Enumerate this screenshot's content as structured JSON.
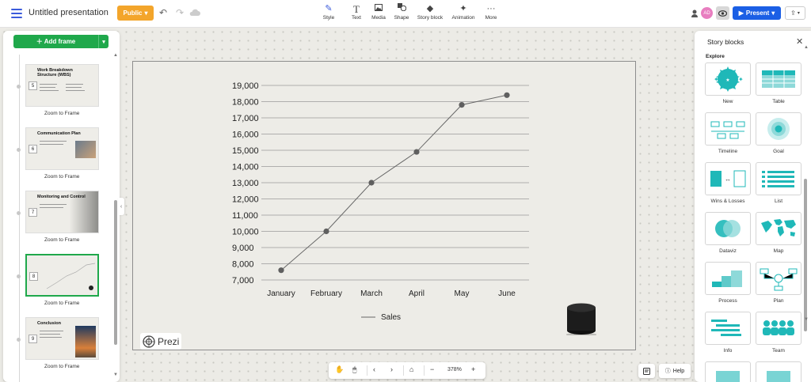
{
  "topbar": {
    "title": "Untitled presentation",
    "public_label": "Public",
    "tools": [
      {
        "label": "Style",
        "icon": "brush-icon"
      },
      {
        "label": "Text",
        "icon": "text-icon"
      },
      {
        "label": "Media",
        "icon": "image-icon"
      },
      {
        "label": "Shape",
        "icon": "shape-icon"
      },
      {
        "label": "Story block",
        "icon": "layers-icon"
      },
      {
        "label": "Animation",
        "icon": "animation-icon"
      },
      {
        "label": "More",
        "icon": "more-icon"
      }
    ],
    "avatar_initials": "AD",
    "present_label": "Present"
  },
  "left_panel": {
    "add_frame_label": "Add frame",
    "frames": [
      {
        "number": "5",
        "title": "Work Breakdown Structure (WBS)",
        "zoom_label": "Zoom to Frame"
      },
      {
        "number": "6",
        "title": "Communication Plan",
        "zoom_label": "Zoom to Frame"
      },
      {
        "number": "7",
        "title": "Monitoring and Control",
        "zoom_label": "Zoom to Frame"
      },
      {
        "number": "8",
        "title": "",
        "zoom_label": "Zoom to Frame"
      },
      {
        "number": "9",
        "title": "Conclusion",
        "zoom_label": "Zoom to Frame"
      }
    ]
  },
  "chart_data": {
    "type": "line",
    "categories": [
      "January",
      "February",
      "March",
      "April",
      "May",
      "June"
    ],
    "series": [
      {
        "name": "Sales",
        "values": [
          7600,
          10000,
          13000,
          14900,
          17800,
          18400
        ],
        "color": "#666666"
      }
    ],
    "y_ticks": [
      "7,000",
      "8,000",
      "9,000",
      "10,000",
      "11,000",
      "12,000",
      "13,000",
      "14,000",
      "15,000",
      "16,000",
      "17,000",
      "18,000",
      "19,000"
    ],
    "ylim": [
      7000,
      19000
    ],
    "legend_position": "bottom",
    "grid": true
  },
  "slide": {
    "logo_text": "Prezi"
  },
  "bottom_bar": {
    "zoom_level": "378%",
    "help_label": "Help"
  },
  "right_panel": {
    "title": "Story blocks",
    "section": "Explore",
    "blocks": [
      {
        "label": "New"
      },
      {
        "label": "Table"
      },
      {
        "label": "Timeline"
      },
      {
        "label": "Goal"
      },
      {
        "label": "Wins & Losses"
      },
      {
        "label": "List"
      },
      {
        "label": "Dataviz"
      },
      {
        "label": "Map"
      },
      {
        "label": "Process"
      },
      {
        "label": "Plan"
      },
      {
        "label": "Info"
      },
      {
        "label": "Team"
      }
    ],
    "accent": "#1fb8b8"
  }
}
